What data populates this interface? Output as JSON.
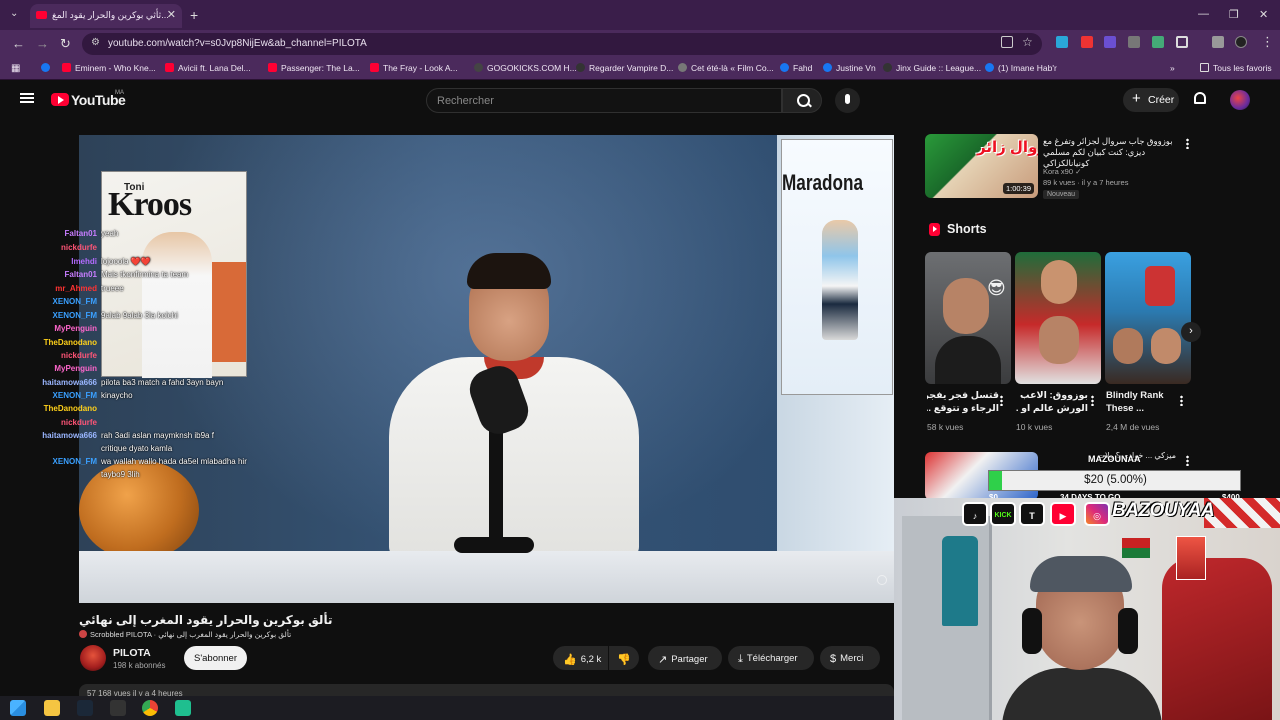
{
  "browser": {
    "tab_title": "ثأثي بوكرين والحرار يقود المغ...",
    "url": "youtube.com/watch?v=s0Jvp8NijEw&ab_channel=PILOTA",
    "bookmarks": [
      {
        "label": "Eminem - Who Kne...",
        "color": "#ff0033"
      },
      {
        "label": "Avicii ft. Lana Del...",
        "color": "#ff0033"
      },
      {
        "label": "Passenger: The La...",
        "color": "#ff0033"
      },
      {
        "label": "The Fray - Look A...",
        "color": "#ff0033"
      },
      {
        "label": "GOGOKICKS.COM H...",
        "color": "#444"
      },
      {
        "label": "Regarder Vampire D...",
        "color": "#333"
      },
      {
        "label": "Cet été-là « Film Co...",
        "color": "#777"
      },
      {
        "label": "Fahd",
        "color": "#1877f2"
      },
      {
        "label": "Justine Vn",
        "color": "#1877f2"
      },
      {
        "label": "Jinx Guide :: League...",
        "color": "#333"
      },
      {
        "label": "(1) Imane Hab'r",
        "color": "#1877f2"
      }
    ],
    "all_bookmarks": "Tous les favoris"
  },
  "youtube": {
    "logo_text": "YouTube",
    "country_code": "MA",
    "search_placeholder": "Rechercher",
    "create_label": "Créer"
  },
  "video": {
    "title": "تألق بوكرين والحرار يقود المغرب إلى نهائي",
    "subline": "Scrobbled PILOTA · تألق بوكرين والحرار يقود المغرب إلى نهائي",
    "channel": "PILOTA",
    "subscribers": "198 k abonnés",
    "subscribe_label": "S'abonner",
    "likes": "6,2 k",
    "share_label": "Partager",
    "download_label": "Télécharger",
    "thanks_label": "Merci",
    "description_peek": "57 168 vues  il y a 4 heures",
    "poster_left_first": "Toni",
    "poster_left_name": "Kroos",
    "poster_right_name": "Maradona"
  },
  "chat": [
    {
      "user": "Faltan01",
      "msg": "yeah",
      "color": "#c77dff"
    },
    {
      "user": "nickdurfe",
      "msg": "",
      "color": "#ff5577"
    },
    {
      "user": "Imehdi",
      "msg": "lojooola ❤️❤️",
      "color": "#b36bff"
    },
    {
      "user": "Faltan01",
      "msg": "Mais tkonfirmina ta team",
      "color": "#c77dff"
    },
    {
      "user": "mr_Ahmed",
      "msg": "trueee",
      "color": "#ff3333"
    },
    {
      "user": "XENON_FM",
      "msg": "",
      "color": "#3aa0ff"
    },
    {
      "user": "XENON_FM",
      "msg": "9alab 9alab 3la kolchi",
      "color": "#3aa0ff"
    },
    {
      "user": "MyPenguin",
      "msg": "",
      "color": "#ff66cc"
    },
    {
      "user": "TheDanodano",
      "msg": "",
      "color": "#ffd11a"
    },
    {
      "user": "nickdurfe",
      "msg": "",
      "color": "#ff5577"
    },
    {
      "user": "MyPenguin",
      "msg": "",
      "color": "#ff66cc"
    },
    {
      "user": "haitamowa666",
      "msg": "pilota ba3 match a fahd 3ayn bayn",
      "color": "#9ab6ff"
    },
    {
      "user": "XENON_FM",
      "msg": "kinaycho",
      "color": "#3aa0ff"
    },
    {
      "user": "TheDanodano",
      "msg": "",
      "color": "#ffd11a"
    },
    {
      "user": "nickdurfe",
      "msg": "",
      "color": "#ff5577"
    },
    {
      "user": "haitamowa666",
      "msg": "rah 3adi aslan maymknsh ib9a f",
      "color": "#9ab6ff"
    },
    {
      "user": "",
      "msg": "critique dyato kamla",
      "color": "#9ab6ff"
    },
    {
      "user": "XENON_FM",
      "msg": "wa wallah wallo hada da5el mlabadha hir",
      "color": "#3aa0ff"
    },
    {
      "user": "",
      "msg": "taybo9 3lih",
      "color": "#3aa0ff"
    }
  ],
  "sidebar": {
    "rec_title": "بوزووق جاب سروال لجزائر وتفرغ مع ديزي: كنت كبيان لكم مسلمي كونيانالكزاكي",
    "rec_thumb_text": "جينا سروال زائر",
    "rec_duration": "1:00:39",
    "rec_channel": "Kora x90 ✓",
    "rec_stats": "89 k vues · il y a 7 heures",
    "rec_badge": "Nouveau",
    "shorts_heading": "Shorts",
    "shorts": [
      {
        "title": "قتسل فجر يفجرها",
        "title2": "الرجاء و تتوقع ...",
        "views": "58 k vues"
      },
      {
        "title": "بوزووق: الاعب",
        "title2": "الورش عالم او ...",
        "views": "10 k vues"
      },
      {
        "title": "Blindly Rank",
        "title2": "These ...",
        "views": "2,4 M de vues"
      }
    ],
    "rec2_title": "ميزكي ... خوادي ؟ ولات"
  },
  "donation": {
    "name": "MAZOUNAA",
    "amount": "$20 (5.00%)",
    "progress": 0.05,
    "min": "$0",
    "max": "$400",
    "days": "34 DAYS TO GO"
  },
  "social": {
    "handle": "BAZOUYAA",
    "tiktok": "♪",
    "kick": "KICK",
    "twitch": "T",
    "youtube": "▶",
    "instagram": "◎"
  }
}
